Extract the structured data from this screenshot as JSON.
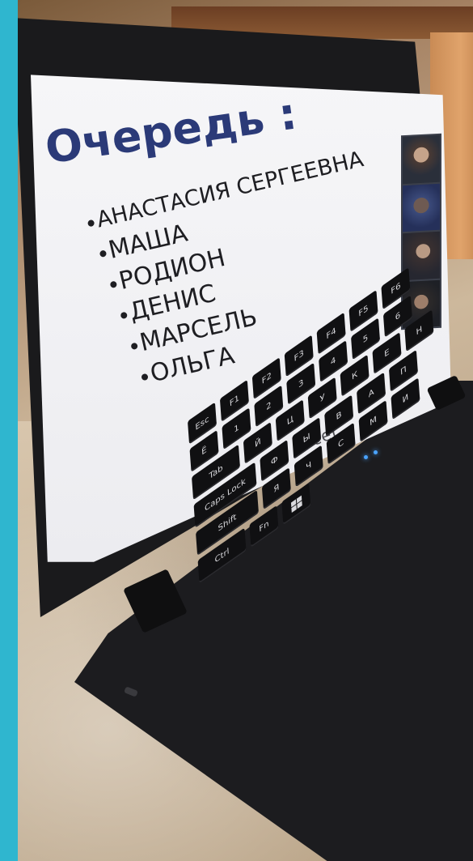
{
  "slide": {
    "title": "Очередь :",
    "items": [
      "АНАСТАСИЯ СЕРГЕЕВНА",
      "МАША",
      "РОДИОН",
      "ДЕНИС",
      "МАРСЕЛЬ",
      "ОЛЬГА"
    ]
  },
  "laptop": {
    "brand": "acer"
  },
  "keyboard": {
    "rows": [
      [
        "Esc",
        "F1",
        "F2",
        "F3",
        "F4",
        "F5",
        "F6"
      ],
      [
        "Ё",
        "1",
        "2",
        "3",
        "4",
        "5",
        "6"
      ],
      [
        "Tab",
        "Й",
        "Ц",
        "У",
        "К",
        "Е",
        "Н"
      ],
      [
        "Caps Lock",
        "Ф",
        "Ы",
        "В",
        "А",
        "П"
      ],
      [
        "Shift",
        "Я",
        "Ч",
        "С",
        "М",
        "И"
      ],
      [
        "Ctrl",
        "Fn",
        "win"
      ]
    ]
  },
  "colors": {
    "background_frame": "#2fb6cf",
    "slide_title": "#2b3a78",
    "slide_text": "#1e1e22",
    "screen": "#f6f6f8",
    "laptop_body": "#1a1a1c"
  },
  "icons": {
    "windows_key": "windows-logo-icon",
    "bullet": "bullet-dot-icon"
  }
}
